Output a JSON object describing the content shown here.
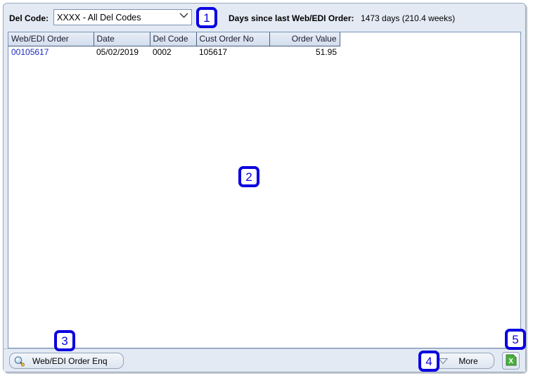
{
  "filter": {
    "del_code_label": "Del Code:",
    "del_code_value": "XXXX - All Del Codes",
    "del_code_options": [
      "XXXX - All Del Codes"
    ],
    "chevron_icon": "chevron-down-icon",
    "days_label": "Days since last Web/EDI Order:",
    "days_value": "1473 days (210.4 weeks)"
  },
  "grid": {
    "columns": [
      {
        "key": "order",
        "label": "Web/EDI Order",
        "align": "left"
      },
      {
        "key": "date",
        "label": "Date",
        "align": "left"
      },
      {
        "key": "del",
        "label": "Del Code",
        "align": "left"
      },
      {
        "key": "cust",
        "label": "Cust Order No",
        "align": "left"
      },
      {
        "key": "value",
        "label": "Order Value",
        "align": "right"
      }
    ],
    "rows": [
      {
        "order": "00105617",
        "date": "05/02/2019",
        "del": "0002",
        "cust": "105617",
        "value": "51.95"
      }
    ]
  },
  "toolbar": {
    "order_enq_label": "Web/EDI Order Enq",
    "order_enq_icon": "magnifier-icon",
    "more_label": "More",
    "more_icon": "triangle-down-icon",
    "export_icon": "excel-export-icon"
  },
  "annotations": [
    {
      "id": "1",
      "label": "1"
    },
    {
      "id": "2",
      "label": "2"
    },
    {
      "id": "3",
      "label": "3"
    },
    {
      "id": "4",
      "label": "4"
    },
    {
      "id": "5",
      "label": "5"
    }
  ],
  "colors": {
    "panel_bg": "#e3eaf4",
    "grid_header": "#d9e2ef",
    "link_text": "#1d2bbd",
    "annotation": "#0a00e0",
    "export_green": "#3faa35"
  }
}
